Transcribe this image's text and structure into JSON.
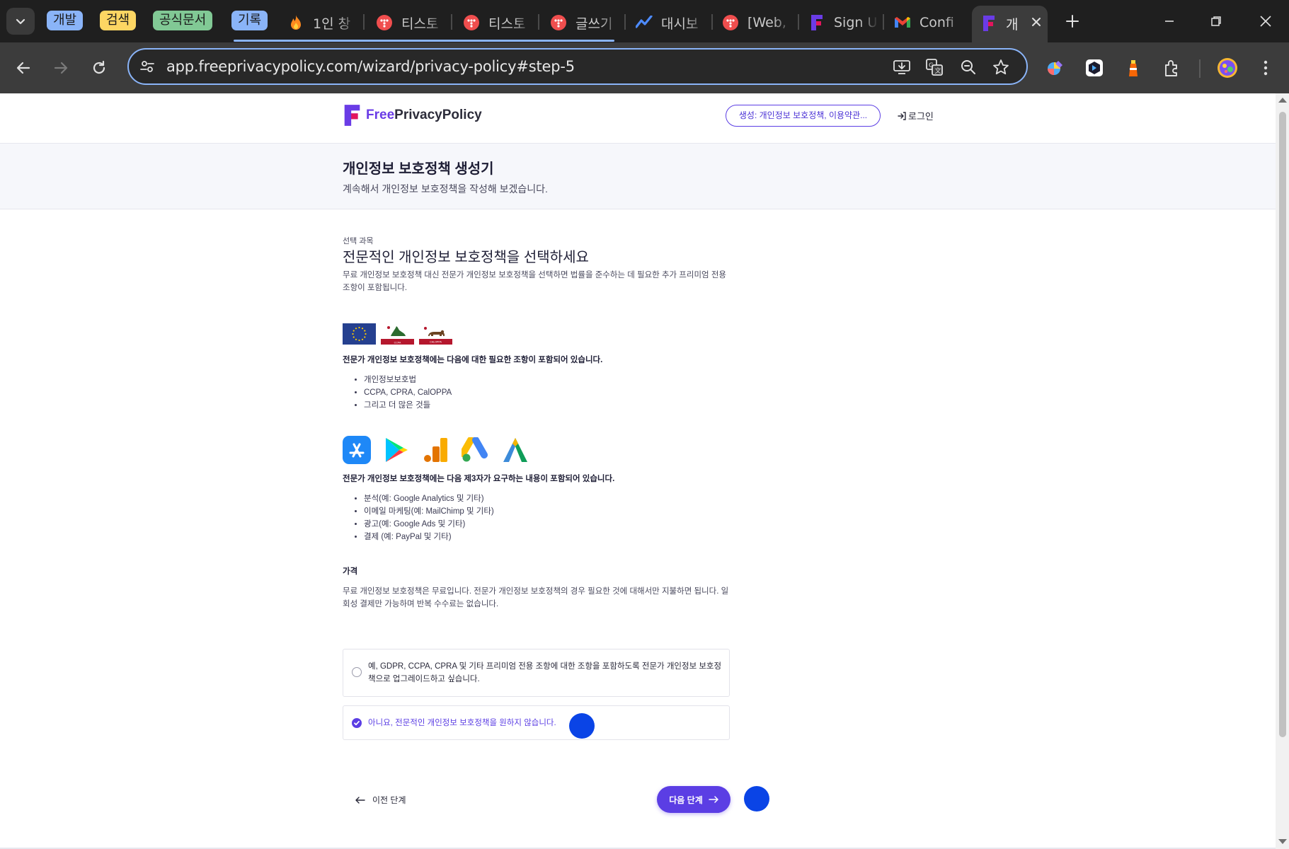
{
  "browser": {
    "tab_groups": [
      {
        "label": "개발",
        "color": "#8ab4f8"
      },
      {
        "label": "검색",
        "color": "#fdd663"
      },
      {
        "label": "공식문서",
        "color": "#81c995"
      },
      {
        "label": "기록",
        "color": "#8ab4f8"
      }
    ],
    "tabs": [
      {
        "title": "1인 창",
        "icon": "fire-icon"
      },
      {
        "title": "티스토",
        "icon": "tistory-icon"
      },
      {
        "title": "티스토",
        "icon": "tistory-icon"
      },
      {
        "title": "글쓰기",
        "icon": "tistory-icon"
      },
      {
        "title": "대시보",
        "icon": "dashboard-icon"
      },
      {
        "title": "[Web,",
        "icon": "tistory-icon"
      },
      {
        "title": "Sign U",
        "icon": "freeprivacypolicy-icon"
      },
      {
        "title": "Confi",
        "icon": "gmail-icon"
      }
    ],
    "active_tab": {
      "title": "개",
      "icon": "freeprivacypolicy-icon"
    },
    "url": "app.freeprivacypolicy.com/wizard/privacy-policy#step-5",
    "accent_color": "#8ab4f8"
  },
  "site": {
    "logo_free": "Free",
    "logo_rest": "PrivacyPolicy",
    "generate_pill": "생성: 개인정보 보호정책, 이용약관...",
    "login": "로그인",
    "brand_color": "#5b3ee4"
  },
  "hero": {
    "title": "개인정보 보호정책 생성기",
    "subtitle": "계속해서 개인정보 보호정책을 작성해 보겠습니다."
  },
  "content": {
    "eyebrow": "선택 과목",
    "heading": "전문적인 개인정보 보호정책을 선택하세요",
    "description": "무료 개인정보 보호정책 대신 전문가 개인정보 보호정책을 선택하면 법률을 준수하는 데 필요한 추가 프리미엄 전용 조항이 포함됩니다.",
    "flag_labels": [
      "CCPA",
      "CALOPPA"
    ],
    "laws_intro": "전문가 개인정보 보호정책에는 다음에 대한 필요한 조항이 포함되어 있습니다.",
    "laws": [
      "개인정보보호법",
      "CCPA, CPRA, CalOPPA",
      "그리고 더 많은 것들"
    ],
    "third_party_intro": "전문가 개인정보 보호정책에는 다음 제3자가 요구하는 내용이 포함되어 있습니다.",
    "third_party": [
      "분석(예: Google Analytics 및 기타)",
      "이메일 마케팅(예: MailChimp 및 기타)",
      "광고(예: Google Ads 및 기타)",
      "결제 (예: PayPal 및 기타)"
    ],
    "price_title": "가격",
    "price_text": "무료 개인정보 보호정책은 무료입니다. 전문가 개인정보 보호정책의 경우 필요한 것에 대해서만 지불하면 됩니다. 일회성 결제만 가능하며 반복 수수료는 없습니다.",
    "options": [
      {
        "label": "예, GDPR, CCPA, CPRA 및 기타 프리미엄 전용 조항에 대한 조항을 포함하도록 전문가 개인정보 보호정책으로 업그레이드하고 싶습니다.",
        "selected": false
      },
      {
        "label": "아니요, 전문적인 개인정보 보호정책을 원하지 않습니다.",
        "selected": true
      }
    ],
    "prev_label": "이전 단계",
    "next_label": "다음 단계"
  }
}
